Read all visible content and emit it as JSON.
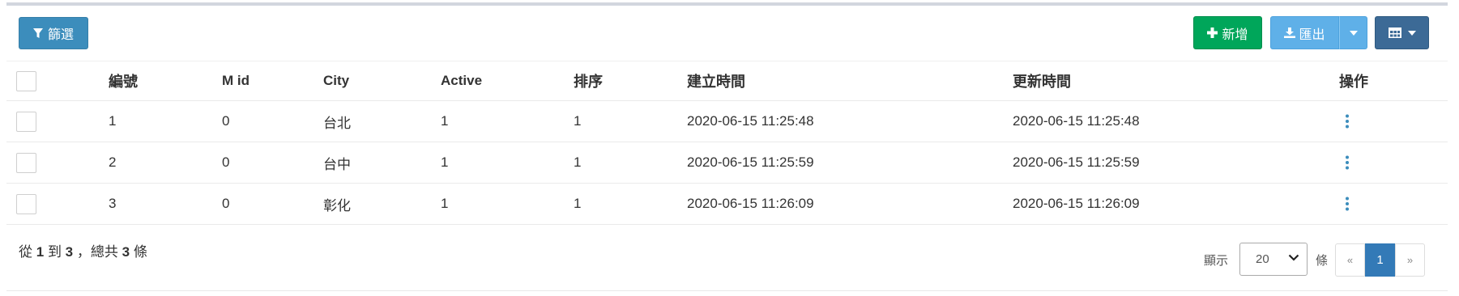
{
  "toolbar": {
    "filter_label": "篩選",
    "add_label": "新增",
    "export_label": "匯出"
  },
  "colors": {
    "primary": "#3c8dbc",
    "success": "#00a65a",
    "export": "#5fb0e8",
    "columns": "#3c6a96",
    "active_page": "#337ab7"
  },
  "table": {
    "headers": {
      "id": "編號",
      "mid": "M id",
      "city": "City",
      "active": "Active",
      "sort": "排序",
      "created": "建立時間",
      "updated": "更新時間",
      "actions": "操作"
    },
    "rows": [
      {
        "id": "1",
        "mid": "0",
        "city": "台北",
        "active": "1",
        "sort": "1",
        "created": "2020-06-15 11:25:48",
        "updated": "2020-06-15 11:25:48"
      },
      {
        "id": "2",
        "mid": "0",
        "city": "台中",
        "active": "1",
        "sort": "1",
        "created": "2020-06-15 11:25:59",
        "updated": "2020-06-15 11:25:59"
      },
      {
        "id": "3",
        "mid": "0",
        "city": "彰化",
        "active": "1",
        "sort": "1",
        "created": "2020-06-15 11:26:09",
        "updated": "2020-06-15 11:26:09"
      }
    ],
    "action_icon": "vertical-ellipsis-icon"
  },
  "footer": {
    "summary_from_word": "從",
    "summary_from": "1",
    "summary_to_word": "到",
    "summary_to": "3",
    "summary_total_word": "，總共",
    "summary_total": "3",
    "summary_unit": "條",
    "show_label": "顯示",
    "page_size": "20",
    "rows_label": "條",
    "prev_label": "«",
    "current_page": "1",
    "next_label": "»"
  }
}
